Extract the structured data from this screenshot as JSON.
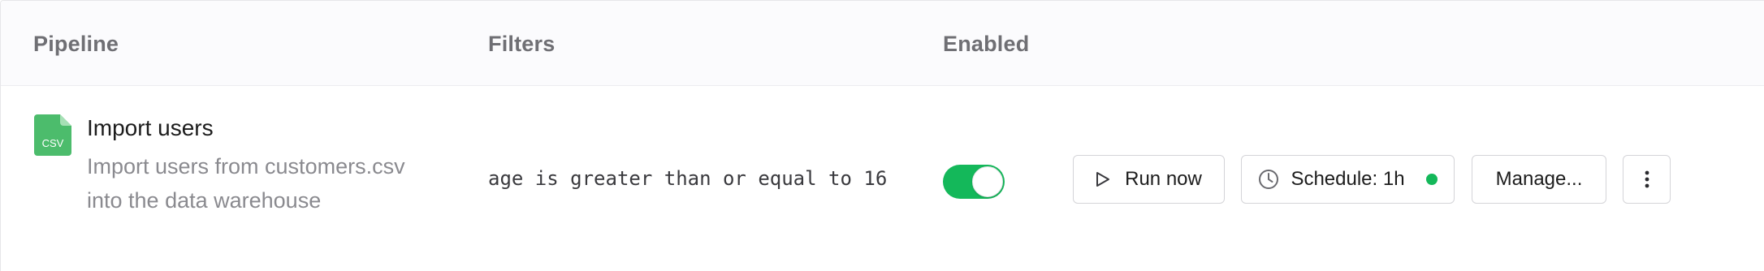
{
  "columns": {
    "pipeline": "Pipeline",
    "filters": "Filters",
    "enabled": "Enabled"
  },
  "row": {
    "file_badge": "CSV",
    "file_icon": "csv-file-icon",
    "name": "Import users",
    "description": "Import users from customers.csv into the data warehouse",
    "filter": "age is greater than or equal to 16",
    "enabled": true,
    "actions": {
      "run_label": "Run now",
      "run_icon": "play-icon",
      "schedule_label": "Schedule: 1h",
      "schedule_icon": "clock-icon",
      "schedule_status_color": "#14b85a",
      "manage_label": "Manage...",
      "more_icon": "more-vertical-icon"
    }
  },
  "colors": {
    "accent_green": "#14b85a",
    "file_icon_green": "#4cbc6c",
    "header_bg": "#fbfbfd",
    "muted_text": "#8a8a8f"
  }
}
